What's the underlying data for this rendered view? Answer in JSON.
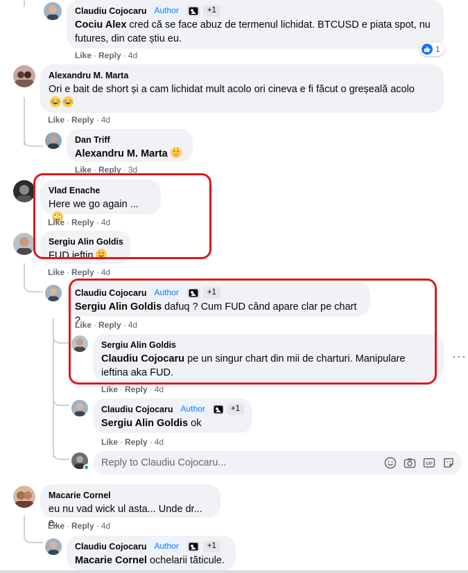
{
  "comments": [
    {
      "author": "Claudiu Cojocaru",
      "badge": "Author",
      "plus": "+1",
      "mention": "Cociu Alex",
      "text_a": " cred că se face abuz de termenul lichidat. BTCUSD e piata spot, nu",
      "text_b": "futures, din cate știu eu.",
      "like": "Like",
      "reply": "Reply",
      "time": "4d",
      "reaction_count": "1"
    },
    {
      "author": "Alexandru M. Marta",
      "text": "Ori e bait de short și a cam lichidat mult acolo ori cineva e fi făcut o greșeală acolo",
      "like": "Like",
      "reply": "Reply",
      "time": "4d"
    },
    {
      "author": "Dan Triff",
      "mention": "Alexandru M. Marta",
      "like": "Like",
      "reply": "Reply",
      "time": "3d"
    },
    {
      "author": "Vlad Enache",
      "text": "Here we go again ...",
      "like": "Like",
      "reply": "Reply",
      "time": "4d"
    },
    {
      "author": "Sergiu Alin Goldis",
      "text": "FUD ieftin",
      "like": "Like",
      "reply": "Reply",
      "time": "4d"
    },
    {
      "author": "Claudiu Cojocaru",
      "badge": "Author",
      "plus": "+1",
      "mention": "Sergiu Alin Goldis",
      "text": " dafuq ? Cum FUD când apare clar pe chart ?",
      "like": "Like",
      "reply": "Reply",
      "time": "4d"
    },
    {
      "author": "Sergiu Alin Goldis",
      "mention": "Claudiu Cojocaru",
      "text_a": " pe un singur chart din mii de charturi. Manipulare",
      "text_b": "ieftina aka FUD.",
      "like": "Like",
      "reply": "Reply",
      "time": "4d"
    },
    {
      "author": "Claudiu Cojocaru",
      "badge": "Author",
      "plus": "+1",
      "mention": "Sergiu Alin Goldis",
      "text": " ok",
      "like": "Like",
      "reply": "Reply",
      "time": "4d"
    },
    {
      "author": "Macarie Cornel",
      "text": "eu nu vad wick ul asta... Unde dr... e..",
      "like": "Like",
      "reply": "Reply",
      "time": "4d"
    },
    {
      "author": "Claudiu Cojocaru",
      "badge": "Author",
      "plus": "+1",
      "mention": "Macarie Cornel",
      "text": " ochelarii tăticule."
    }
  ],
  "reply_box": {
    "placeholder": "Reply to Claudiu Cojocaru..."
  },
  "icons": [
    "smiley-icon",
    "camera-icon",
    "gif-icon",
    "sticker-icon",
    "more-options-icon",
    "like-reaction-icon"
  ],
  "colors": {
    "accent": "#1877f2",
    "highlight_box": "#e0181b",
    "bubble": "#f0f2f5",
    "secondary_text": "#65676b"
  }
}
